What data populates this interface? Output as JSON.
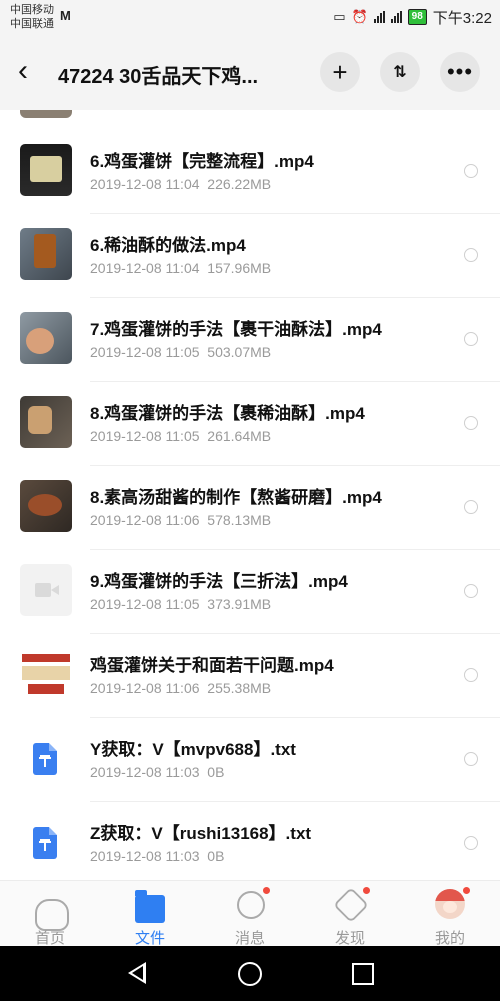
{
  "status_bar": {
    "carrier1": "中国移动",
    "carrier2": "中国联通",
    "app_badge": "M",
    "battery": "98",
    "time": "下午3:22"
  },
  "header": {
    "title": "47224 30舌品天下鸡...",
    "back_icon": "chevron-left-icon",
    "add_icon": "plus-icon",
    "sort_icon": "sort-icon",
    "more_icon": "more-icon"
  },
  "files": [
    {
      "name": "6.鸡蛋灌饼【完整流程】.mp4",
      "date": "2019-12-08",
      "time": "11:04",
      "size": "226.22MB"
    },
    {
      "name": "6.稀油酥的做法.mp4",
      "date": "2019-12-08",
      "time": "11:04",
      "size": "157.96MB"
    },
    {
      "name": "7.鸡蛋灌饼的手法【裹干油酥法】.mp4",
      "date": "2019-12-08",
      "time": "11:05",
      "size": "503.07MB"
    },
    {
      "name": "8.鸡蛋灌饼的手法【裹稀油酥】.mp4",
      "date": "2019-12-08",
      "time": "11:05",
      "size": "261.64MB"
    },
    {
      "name": "8.素高汤甜酱的制作【熬酱研磨】.mp4",
      "date": "2019-12-08",
      "time": "11:06",
      "size": "578.13MB"
    },
    {
      "name": "9.鸡蛋灌饼的手法【三折法】.mp4",
      "date": "2019-12-08",
      "time": "11:05",
      "size": "373.91MB"
    },
    {
      "name": "鸡蛋灌饼关于和面若干问题.mp4",
      "date": "2019-12-08",
      "time": "11:06",
      "size": "255.38MB"
    },
    {
      "name": "Y获取：V【mvpv688】.txt",
      "date": "2019-12-08",
      "time": "11:03",
      "size": "0B"
    },
    {
      "name": "Z获取：V【rushi13168】.txt",
      "date": "2019-12-08",
      "time": "11:03",
      "size": "0B"
    }
  ],
  "bottom_nav": [
    {
      "label": "首页",
      "icon": "cloud-icon",
      "active": false,
      "dot": false
    },
    {
      "label": "文件",
      "icon": "folder-icon",
      "active": true,
      "dot": false
    },
    {
      "label": "消息",
      "icon": "message-icon",
      "active": false,
      "dot": true
    },
    {
      "label": "发现",
      "icon": "discover-icon",
      "active": false,
      "dot": true
    },
    {
      "label": "我的",
      "icon": "avatar-icon",
      "active": false,
      "dot": true
    }
  ],
  "colors": {
    "accent": "#2f7ff2",
    "badge": "#f04a3d",
    "meta_text": "#9a9a9a"
  }
}
